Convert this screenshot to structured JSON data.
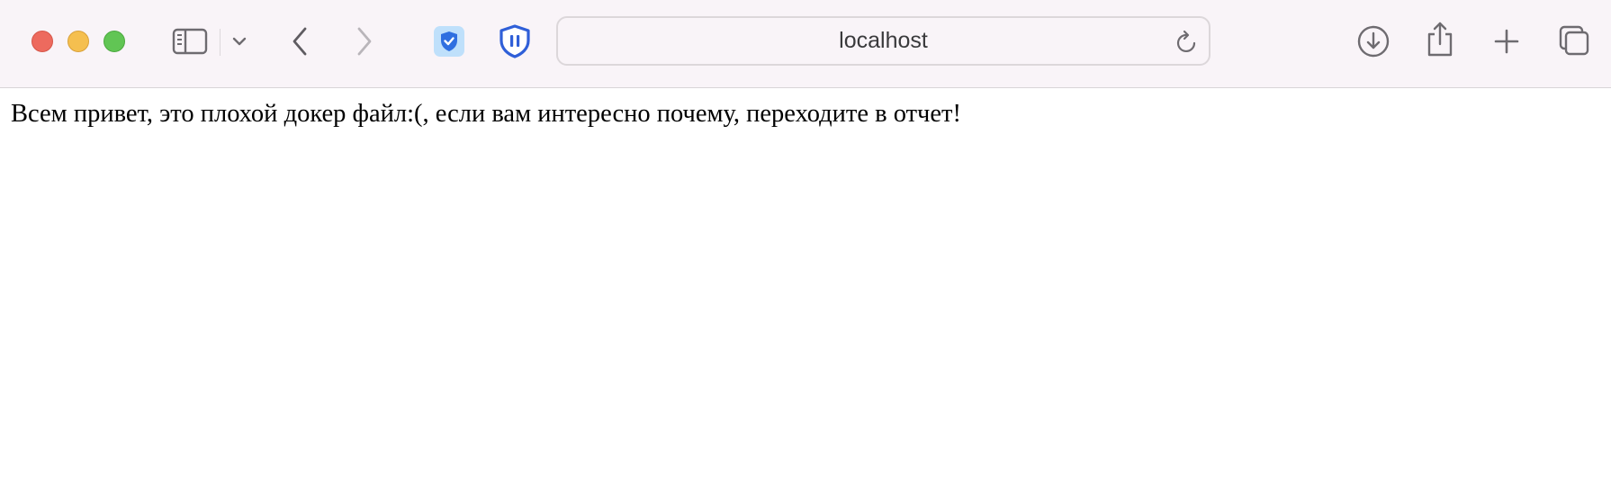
{
  "browser": {
    "address": {
      "url_text": "localhost"
    }
  },
  "page": {
    "body_text": "Всем привет, это плохой докер файл:(, если вам интересно почему, переходите в отчет!"
  },
  "colors": {
    "toolbar_bg": "#f9f4f8",
    "close": "#ed6a5e",
    "minimize": "#f5bf4f",
    "maximize": "#61c554",
    "shield_blue": "#2f5fd8"
  },
  "icons": [
    "sidebar-icon",
    "chevron-down-icon",
    "back-arrow-icon",
    "forward-arrow-icon",
    "shield-check-icon",
    "shield-pause-icon",
    "reload-icon",
    "download-icon",
    "share-icon",
    "plus-icon",
    "tabs-overview-icon"
  ]
}
